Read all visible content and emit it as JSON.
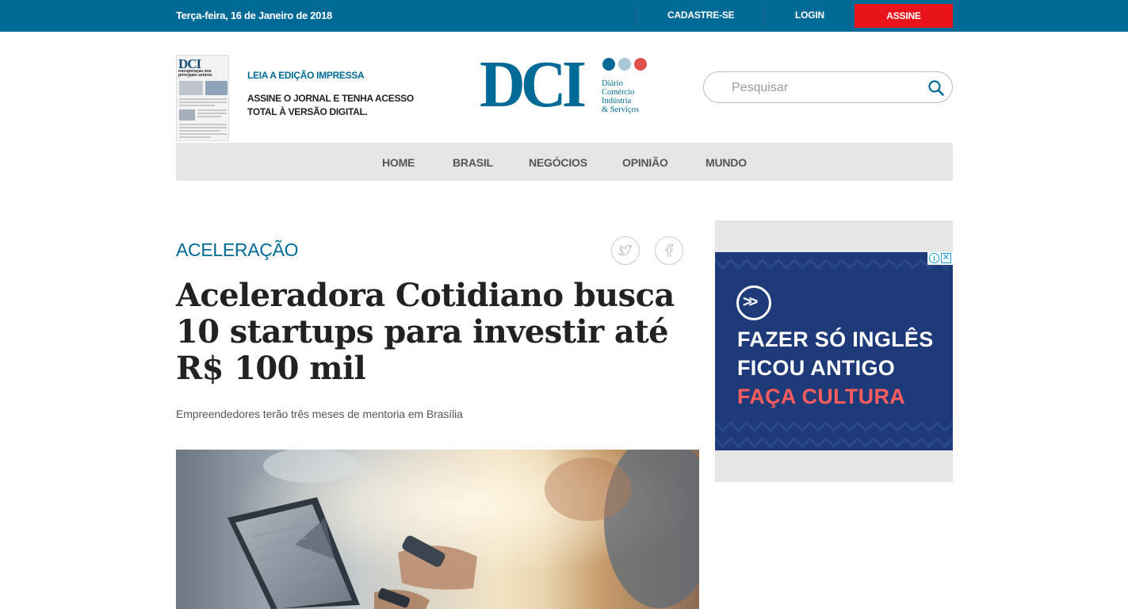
{
  "topbar": {
    "date": "Terça-feira, 16 de Janeiro de 2018",
    "cadastre": "CADASTRE-SE",
    "login": "LOGIN",
    "assine": "ASSINE"
  },
  "header": {
    "print_title": "LEIA A EDIÇÃO IMPRESSA",
    "print_text": "ASSINE O JORNAL E TENHA ACESSO TOTAL À VERSÃO DIGITAL.",
    "print_cover_logo": "DCI",
    "print_cover_headline": "Recuperação dos principais setores impulsiona economia",
    "logo_letters": "DCI",
    "logo_tagline": [
      "Diário",
      "Comércio",
      "Indústria",
      "& Serviços"
    ],
    "logo_dot_colors": [
      "#006a96",
      "#a9c6d6",
      "#e0514b"
    ],
    "search_placeholder": "Pesquisar"
  },
  "nav": {
    "items": [
      "HOME",
      "BRASIL",
      "NEGÓCIOS",
      "OPINIÃO",
      "MUNDO"
    ]
  },
  "article": {
    "kicker": "ACELERAÇÃO",
    "headline": "Aceleradora Cotidiano busca 10 startups para investir até R$ 100 mil",
    "subtitle": "Empreendedores terão três meses de mentoria em Brasília",
    "share_icons": [
      "twitter-icon",
      "facebook-icon"
    ]
  },
  "ad": {
    "line1": "FAZER SÓ INGLÊS",
    "line2": "FICOU ANTIGO",
    "line3": "FAÇA CULTURA",
    "logo_glyph": ">>",
    "adchoices_info": "i",
    "adchoices_close": "✕"
  },
  "colors": {
    "brand_blue": "#006a96",
    "assine_red": "#e8141a",
    "ad_background": "#1e3a79",
    "ad_highlight": "#ff5d5d"
  }
}
